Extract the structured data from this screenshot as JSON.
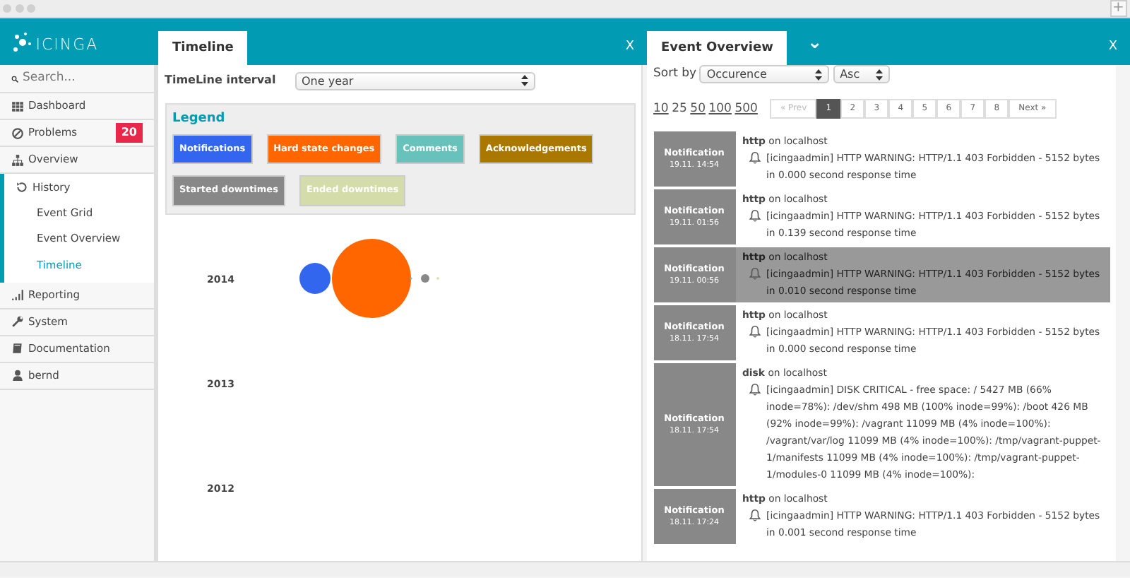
{
  "window": {
    "new_tab": "+"
  },
  "logo": "icinga",
  "sidebar": {
    "search": {
      "placeholder": "Search..."
    },
    "items": [
      {
        "label": "Dashboard",
        "expanded": false
      },
      {
        "label": "Problems",
        "badge": "20",
        "expanded": false
      },
      {
        "label": "Overview",
        "expanded": false
      },
      {
        "label": "History",
        "expanded": true,
        "children": [
          {
            "label": "Event Grid",
            "selected": false
          },
          {
            "label": "Event Overview",
            "selected": false
          },
          {
            "label": "Timeline",
            "selected": true
          }
        ]
      },
      {
        "label": "Reporting",
        "expanded": false
      },
      {
        "label": "System",
        "expanded": false
      },
      {
        "label": "Documentation",
        "expanded": false
      },
      {
        "label": "bernd",
        "expanded": false
      }
    ]
  },
  "timeline_panel": {
    "tab": "Timeline",
    "close": "X",
    "interval_label": "TimeLine interval",
    "interval_value": "One year",
    "legend": {
      "title": "Legend",
      "items": [
        {
          "label": "Notifications",
          "color": "#3366ee"
        },
        {
          "label": "Hard state changes",
          "color": "#ff6600"
        },
        {
          "label": "Comments",
          "color": "#66c2bb"
        },
        {
          "label": "Acknowledgements",
          "color": "#aa7700"
        },
        {
          "label": "Started downtimes",
          "color": "#888888"
        },
        {
          "label": "Ended downtimes",
          "color": "#d4dcaa"
        }
      ]
    },
    "years": [
      "2014",
      "2013",
      "2012"
    ]
  },
  "event_panel": {
    "tab": "Event Overview",
    "chevron": "⌄",
    "close": "X",
    "sort_label": "Sort by",
    "sort_value": "Occurence",
    "order_value": "Asc",
    "page_sizes": [
      {
        "label": "10",
        "selected": false
      },
      {
        "label": "25",
        "selected": true
      },
      {
        "label": "50",
        "selected": false
      },
      {
        "label": "100",
        "selected": false
      },
      {
        "label": "500",
        "selected": false
      }
    ],
    "pagination": [
      {
        "label": "« Prev",
        "selected": false,
        "disabled": true
      },
      {
        "label": "1",
        "selected": true,
        "disabled": false
      },
      {
        "label": "2",
        "selected": false,
        "disabled": false
      },
      {
        "label": "3",
        "selected": false,
        "disabled": false
      },
      {
        "label": "4",
        "selected": false,
        "disabled": false
      },
      {
        "label": "5",
        "selected": false,
        "disabled": false
      },
      {
        "label": "6",
        "selected": false,
        "disabled": false
      },
      {
        "label": "7",
        "selected": false,
        "disabled": false
      },
      {
        "label": "8",
        "selected": false,
        "disabled": false
      },
      {
        "label": "Next »",
        "selected": false,
        "disabled": false
      }
    ],
    "events": [
      {
        "type": "Notification",
        "time": "19.11. 14:54",
        "service": "http",
        "host": "on localhost",
        "message": "[icingaadmin] HTTP WARNING: HTTP/1.1 403 Forbidden - 5152 bytes in 0.000 second response time",
        "selected": false
      },
      {
        "type": "Notification",
        "time": "19.11. 01:56",
        "service": "http",
        "host": "on localhost",
        "message": "[icingaadmin] HTTP WARNING: HTTP/1.1 403 Forbidden - 5152 bytes in 0.139 second response time",
        "selected": false
      },
      {
        "type": "Notification",
        "time": "19.11. 00:56",
        "service": "http",
        "host": "on localhost",
        "message": "[icingaadmin] HTTP WARNING: HTTP/1.1 403 Forbidden - 5152 bytes in 0.010 second response time",
        "selected": true
      },
      {
        "type": "Notification",
        "time": "18.11. 17:54",
        "service": "http",
        "host": "on localhost",
        "message": "[icingaadmin] HTTP WARNING: HTTP/1.1 403 Forbidden - 5152 bytes in 0.000 second response time",
        "selected": false
      },
      {
        "type": "Notification",
        "time": "18.11. 17:54",
        "service": "disk",
        "host": "on localhost",
        "message": "[icingaadmin] DISK CRITICAL - free space: / 5427 MB (66% inode=78%): /dev/shm 498 MB (100% inode=99%): /boot 426 MB (92% inode=99%): /vagrant 11099 MB (4% inode=100%): /vagrant/var/log 11099 MB (4% inode=100%): /tmp/vagrant-puppet-1/manifests 11099 MB (4% inode=100%): /tmp/vagrant-puppet-1/modules-0 11099 MB (4% inode=100%):",
        "selected": false
      },
      {
        "type": "Notification",
        "time": "18.11. 17:24",
        "service": "http",
        "host": "on localhost",
        "message": "[icingaadmin] HTTP WARNING: HTTP/1.1 403 Forbidden - 5152 bytes in 0.001 second response time",
        "selected": false
      }
    ]
  }
}
